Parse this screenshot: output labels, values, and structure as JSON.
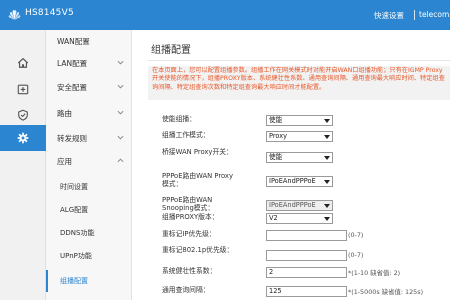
{
  "header": {
    "brand": "HS8145V5",
    "quick_setup": "快速设置",
    "operator": "telecom"
  },
  "sidebar_icons": [
    {
      "name": "home-icon"
    },
    {
      "name": "plus-box-icon"
    },
    {
      "name": "shield-icon"
    },
    {
      "name": "gear-icon",
      "active": true
    }
  ],
  "menu": {
    "items": [
      {
        "label": "WAN配置"
      },
      {
        "label": "LAN配置"
      },
      {
        "label": "安全配置"
      },
      {
        "label": "路由"
      },
      {
        "label": "转发规则"
      },
      {
        "label": "应用"
      },
      {
        "label": "时间设置"
      },
      {
        "label": "ALG配置"
      },
      {
        "label": "DDNS功能"
      },
      {
        "label": "UPnP功能"
      },
      {
        "label": "组播配置"
      }
    ]
  },
  "page": {
    "title": "组播配置",
    "notice": "在本页面上，您可以配置组播参数。组播工作在网关模式时对能开启WAN口组播功能；只有在IGMP Proxy开关使能的情况下，组播PROXY版本、系统健壮性系数、通用查询间隔、通用查询最大响应时间、特定组查询间隔、特定组查询次数和特定组查询最大响应时间才能配置。"
  },
  "form": {
    "multicast_enable": {
      "label": "使能组播：",
      "value": "使能"
    },
    "work_mode": {
      "label": "组播工作模式：",
      "value": "Proxy"
    },
    "bridge_wan_proxy": {
      "label": "桥接WAN Proxy开关：",
      "value": "使能"
    },
    "pppoe_wan_proxy": {
      "label": "PPPoE路由WAN Proxy模式：",
      "value": "IPoEAndPPPoE"
    },
    "pppoe_wan_snooping": {
      "label": "PPPoE路由WAN Snooping模式：",
      "value": "IPoEAndPPPoE"
    },
    "proxy_version": {
      "label": "组播PROXY版本：",
      "value": "V2"
    },
    "remark_ip_priority": {
      "label": "重标记IP优先级：",
      "value": "",
      "hint": "(0-7)"
    },
    "remark_8021p_priority": {
      "label": "重标记802.1p优先级：",
      "value": "",
      "hint": "(0-7)"
    },
    "robustness": {
      "label": "系统健壮性系数：",
      "value": "2",
      "hint": "*(1-10 缺省值: 2)"
    },
    "query_interval": {
      "label": "通用查询间隔：",
      "value": "125",
      "hint": "*(1-5000s 缺省值: 125s)"
    }
  },
  "colors": {
    "primary": "#2b85d0",
    "notice_text": "#e8582a",
    "required": "#e8582a"
  }
}
